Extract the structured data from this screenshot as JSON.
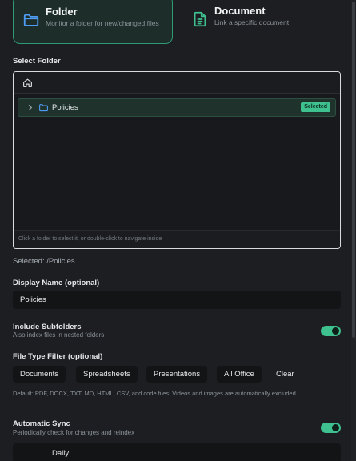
{
  "source_types": {
    "folder": {
      "title": "Folder",
      "description": "Monitor a folder for new/changed files",
      "selected": true
    },
    "document": {
      "title": "Document",
      "description": "Link a specific document",
      "selected": false
    }
  },
  "select_folder": {
    "label": "Select Folder",
    "folders": [
      {
        "name": "Policies",
        "badge": "Selected"
      }
    ],
    "hint": "Click a folder to select it, or double-click to navigate inside",
    "selected_text": "Selected: /Policies"
  },
  "display_name": {
    "label": "Display Name (optional)",
    "value": "Policies"
  },
  "include_subfolders": {
    "title": "Include Subfolders",
    "description": "Also index files in nested folders",
    "enabled": true
  },
  "file_type_filter": {
    "label": "File Type Filter (optional)",
    "chips": [
      "Documents",
      "Spreadsheets",
      "Presentations",
      "All Office",
      "Clear"
    ],
    "help": "Default: PDF, DOCX, TXT, MD, HTML, CSV, and code files. Videos and images are automatically excluded."
  },
  "automatic_sync": {
    "title": "Automatic Sync",
    "description": "Periodically check for changes and reindex",
    "enabled": true,
    "frequency": "Daily..."
  },
  "colors": {
    "accent": "#3ec08f",
    "background": "#1c1e22",
    "input_bg": "#121416"
  }
}
